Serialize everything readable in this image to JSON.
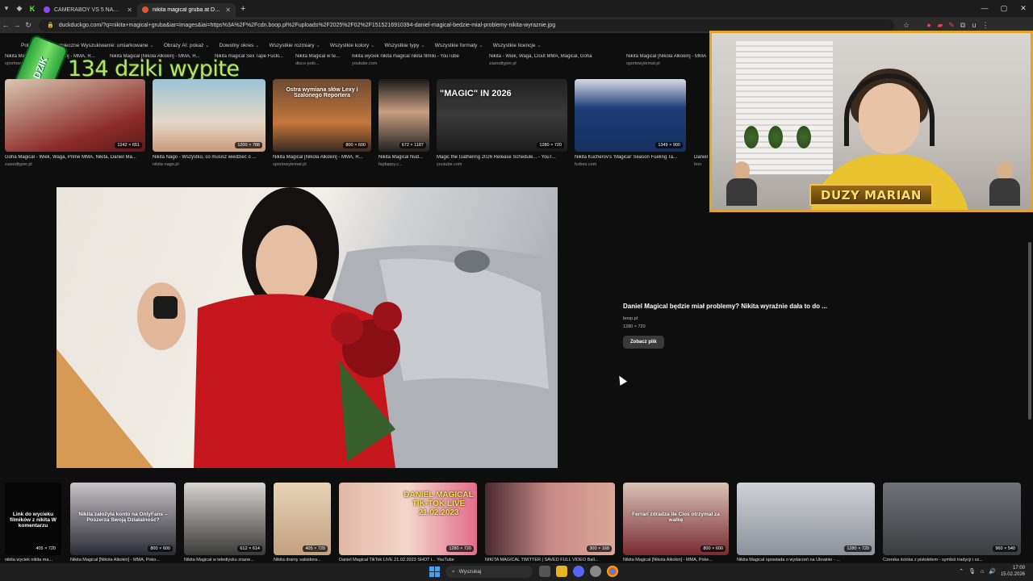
{
  "browser": {
    "tabs": [
      {
        "label": "CAMERABOY VS 5 NAGICH KO...",
        "active": false,
        "color": "#9147ff"
      },
      {
        "label": "nikita magical gruba at DuckD...",
        "active": true,
        "color": "#de5833"
      }
    ],
    "url": "duckduckgo.com/?q=nikita+magical+gruba&iar=images&iai=https%3A%2F%2Fcdn.boop.pl%2Fuploads%2F2025%2F02%2F1515216910394-daniel-magical-bedzie-mial-problemy-nikita-wyraznie.jpg"
  },
  "filters": [
    "Polska",
    "Bezpieczne Wyszukiwanie: umiarkowane",
    "Obrazy AI: pokaż",
    "Dowolny okres",
    "Wszystkie rozmiary",
    "Wszystkie kolory",
    "Wszystkie typy",
    "Wszystkie formaty",
    "Wszystkie licencje"
  ],
  "top_captions": [
    {
      "title": "Nikita Magical [Nikola Alkokin] - MMA, R...",
      "source": "sportowytemat.pl"
    },
    {
      "title": "Nikita Magical [Nikola Alkokin] - MMA, R...",
      "source": ""
    },
    {
      "title": "Nikita magical Sex Tape Fucki...",
      "source": ""
    },
    {
      "title": "Nikita Magical w te...",
      "source": "disco-polo..."
    },
    {
      "title": "nikita wyciek nikita magical nikita filmiki - YouTube",
      "source": "youtube.com"
    },
    {
      "title": "Nikita - Wiek, Waga, Clout MMA, Magical, Goha",
      "source": "zawodtyper.pl"
    },
    {
      "title": "Nikita Magical [Nikola Alkokin] - MMA",
      "source": "sportowytemat.pl"
    }
  ],
  "overlay": {
    "counter": "134 dziki wypite",
    "can_label": "DZIK"
  },
  "thumbs": [
    {
      "dims": "1242 × 651",
      "title": "Goha Magical - Wiek, Waga, Prime MMA, Nikita, Daniel Ma...",
      "source": "zawodtyper.pl",
      "overlay": ""
    },
    {
      "dims": "1200 × 788",
      "title": "Nikita Nago - Wszystko, co musisz wiedzieć o ...",
      "source": "nikita-nago.pl",
      "overlay": ""
    },
    {
      "dims": "800 × 600",
      "title": "Nikita Magical [Nikola Alkokin] - MMA, R...",
      "source": "sportowytemat.pl",
      "overlay": "Ostra wymiana słów Lexy i Szalonego Reportera"
    },
    {
      "dims": "672 × 1187",
      "title": "Nikita Magical Nud...",
      "source": "fapfappy.c...",
      "overlay": ""
    },
    {
      "dims": "1280 × 720",
      "title": "Magic the Gathering 2026 Release Schedule... - YouT...",
      "source": "youtube.com",
      "overlay": "\"MAGIC\" IN 2026"
    },
    {
      "dims": "1349 × 900",
      "title": "Nikita Kucherov's 'Magical' Season Fueling Ta...",
      "source": "forbes.com",
      "overlay": ""
    },
    {
      "dims": "",
      "title": "Daniel",
      "source": "boo",
      "overlay": ""
    }
  ],
  "detail": {
    "title": "Daniel Magical będzie miał problemy? Nikita wyraźnie dała to do ...",
    "source": "boop.pl",
    "dims": "1280 × 720",
    "button": "Zobacz plik"
  },
  "bottom": [
    {
      "dims": "405 × 720",
      "title": "nikita wyciek nikita ma...",
      "overlay": "Link do wycieku filmików z nikita W komentarzu"
    },
    {
      "dims": "800 × 600",
      "title": "Nikita Magical [Nikola Alkokin] - MMA, Poko...",
      "overlay": "Nikita założyła konto na OnlyFans – Poszerza Swoją Działalność?"
    },
    {
      "dims": "612 × 614",
      "title": "Nikita Magical w telediysku znane...",
      "overlay": ""
    },
    {
      "dims": "405 × 720",
      "title": "Nikita dramy salsidora...",
      "overlay": ""
    },
    {
      "dims": "1280 × 720",
      "title": "Daniel Magical TikTok LIVE 21.02.2023 SHOT i... YouTube",
      "overlay": "DANIEL MAGICAL TIK-TOK LIVE 21.02.2023"
    },
    {
      "dims": "300 × 168",
      "title": "NIKITA MAGICAL TWITTER | SAVED FULL VIDEO Ball...",
      "overlay": ""
    },
    {
      "dims": "800 × 600",
      "title": "Nikita Magical [Nikola Alkokin] - MMA, Poke...",
      "overlay": "Ferrari zdradza ile Cios otrzymał za walkę"
    },
    {
      "dims": "1280 × 720",
      "title": "Nikita Magical opowiada o wydarzeń na Ukrainie - ...",
      "overlay": ""
    },
    {
      "dims": "960 × 540",
      "title": "Czerska ścinka z pistoletem - symbol tradycji i sz...",
      "overlay": ""
    }
  ],
  "stream": {
    "nameplate": "DUZY MARIAN"
  },
  "taskbar": {
    "search": "Wyszukaj",
    "time": "17:00",
    "date": "15.02.2026"
  }
}
